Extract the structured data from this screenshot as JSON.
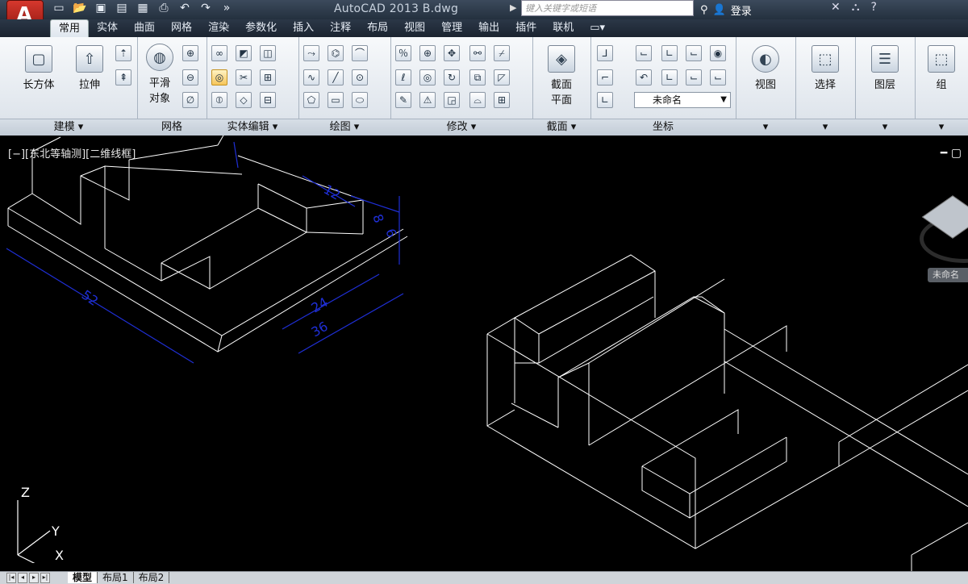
{
  "titlebar": {
    "app_letter": "A",
    "title": "AutoCAD 2013   B.dwg",
    "search_placeholder": "键入关键字或短语",
    "login": "登录",
    "help": "?"
  },
  "tabs": [
    "常用",
    "实体",
    "曲面",
    "网格",
    "渲染",
    "参数化",
    "插入",
    "注释",
    "布局",
    "视图",
    "管理",
    "输出",
    "插件",
    "联机"
  ],
  "active_tab": "常用",
  "ribbon": {
    "modeling": {
      "title": "建模 ▾",
      "box_label": "长方体",
      "extrude_label": "拉伸"
    },
    "mesh": {
      "title": "网格",
      "smooth_label_line1": "平滑",
      "smooth_label_line2": "对象"
    },
    "solid_edit": {
      "title": "实体编辑 ▾"
    },
    "draw": {
      "title": "绘图 ▾"
    },
    "modify": {
      "title": "修改 ▾"
    },
    "section": {
      "title": "截面 ▾",
      "plane_line1": "截面",
      "plane_line2": "平面"
    },
    "coordinates": {
      "title": "坐标",
      "dropdown_value": "未命名"
    },
    "view": {
      "label": "视图"
    },
    "select": {
      "label": "选择"
    },
    "layers": {
      "label": "图层"
    },
    "group": {
      "label": "组"
    }
  },
  "viewport": {
    "label": "[−][东北等轴测][二维线框]",
    "unnamed_button": "未命名",
    "dimensions": [
      "12",
      "8",
      "6",
      "52",
      "24",
      "36"
    ],
    "ucs": {
      "z": "Z",
      "y": "Y",
      "x": "X"
    },
    "colors": {
      "geometry": "#ffffff",
      "dimension": "#1f2fd6",
      "background": "#000000"
    }
  },
  "statusbar": {
    "layout_tabs": [
      "模型",
      "布局1",
      "布局2"
    ],
    "active_layout": "模型"
  }
}
